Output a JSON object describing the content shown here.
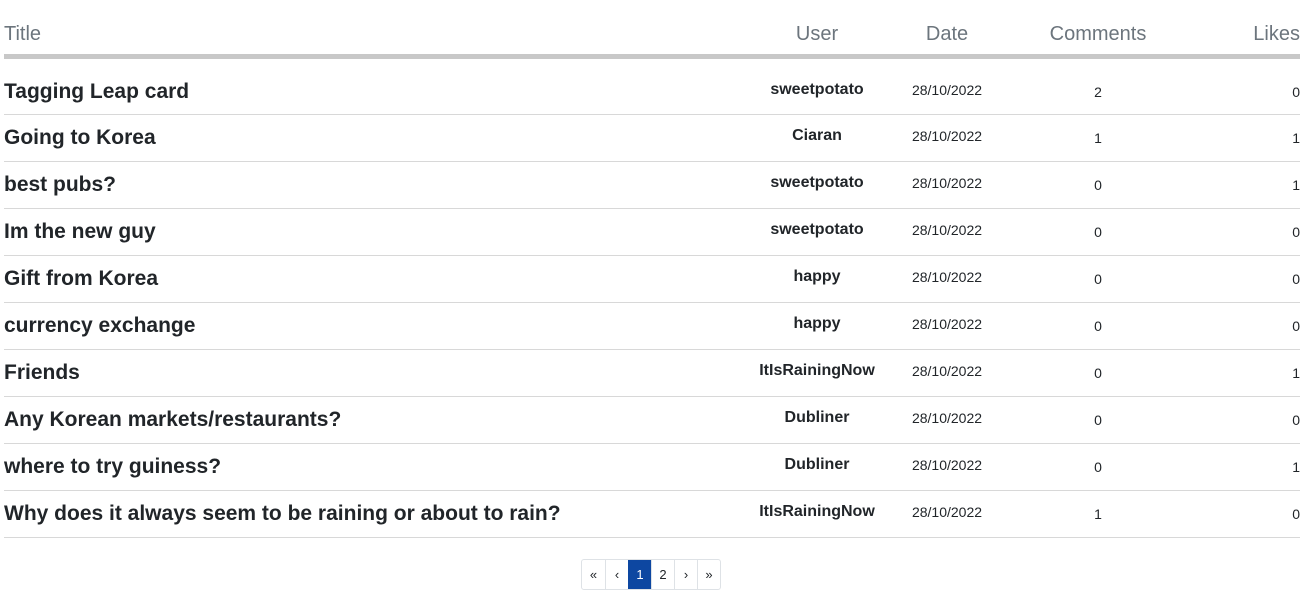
{
  "table": {
    "headers": {
      "title": "Title",
      "user": "User",
      "date": "Date",
      "comments": "Comments",
      "likes": "Likes"
    },
    "rows": [
      {
        "title": "Tagging Leap card",
        "user": "sweetpotato",
        "date": "28/10/2022",
        "comments": "2",
        "likes": "0"
      },
      {
        "title": "Going to Korea",
        "user": "Ciaran",
        "date": "28/10/2022",
        "comments": "1",
        "likes": "1"
      },
      {
        "title": "best pubs?",
        "user": "sweetpotato",
        "date": "28/10/2022",
        "comments": "0",
        "likes": "1"
      },
      {
        "title": "Im the new guy",
        "user": "sweetpotato",
        "date": "28/10/2022",
        "comments": "0",
        "likes": "0"
      },
      {
        "title": "Gift from Korea",
        "user": "happy",
        "date": "28/10/2022",
        "comments": "0",
        "likes": "0"
      },
      {
        "title": "currency exchange",
        "user": "happy",
        "date": "28/10/2022",
        "comments": "0",
        "likes": "0"
      },
      {
        "title": "Friends",
        "user": "ItIsRainingNow",
        "date": "28/10/2022",
        "comments": "0",
        "likes": "1"
      },
      {
        "title": "Any Korean markets/restaurants?",
        "user": "Dubliner",
        "date": "28/10/2022",
        "comments": "0",
        "likes": "0"
      },
      {
        "title": "where to try guiness?",
        "user": "Dubliner",
        "date": "28/10/2022",
        "comments": "0",
        "likes": "1"
      },
      {
        "title": "Why does it always seem to be raining or about to rain?",
        "user": "ItIsRainingNow",
        "date": "28/10/2022",
        "comments": "1",
        "likes": "0"
      }
    ]
  },
  "pagination": {
    "first": "«",
    "prev": "‹",
    "pages": [
      "1",
      "2"
    ],
    "current": "1",
    "next": "›",
    "last": "»"
  },
  "colors": {
    "header_text": "#6c757d",
    "header_rule": "#c8c8c8",
    "row_rule": "#d8d8d8",
    "active_page": "#0d47a1"
  }
}
